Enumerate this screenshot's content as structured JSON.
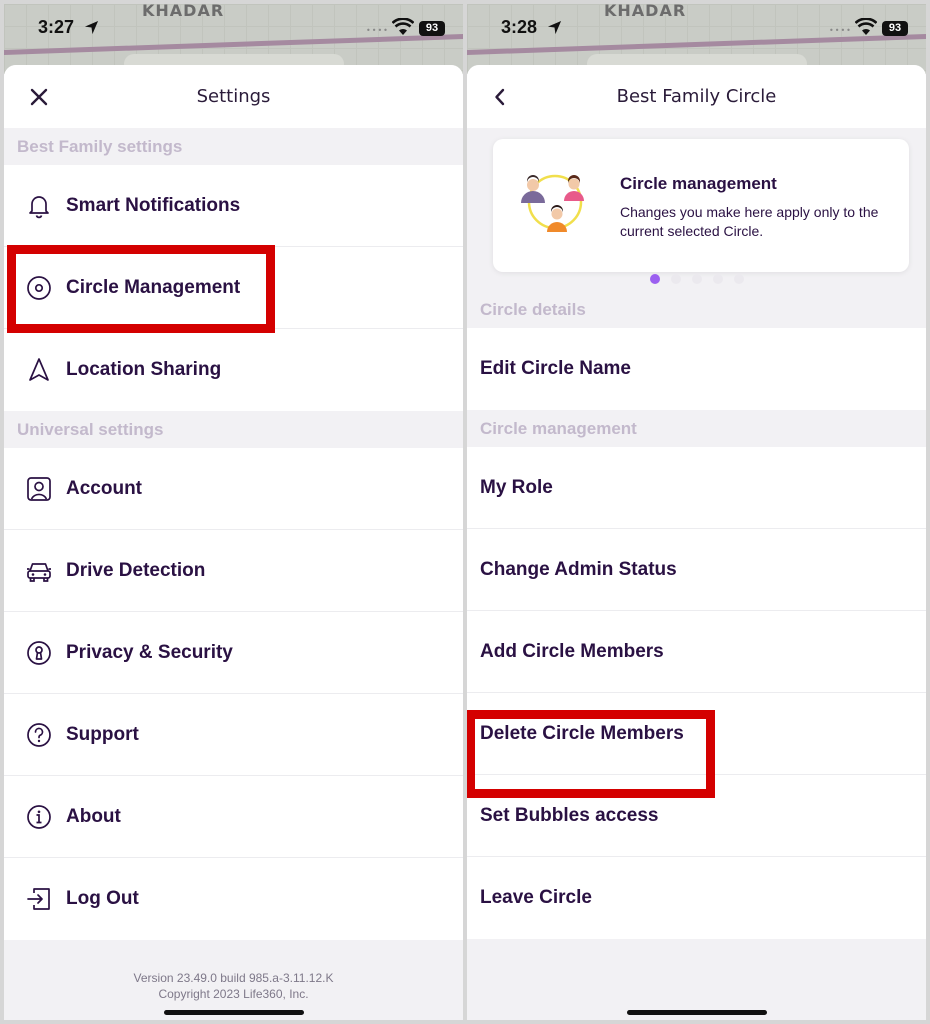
{
  "colors": {
    "highlight": "#d40000",
    "accent": "#9c60f0",
    "text": "#2a1143",
    "section_text": "#c3b9cc"
  },
  "left": {
    "status": {
      "time": "3:27",
      "battery": "93"
    },
    "map_label": "KHADAR",
    "header": {
      "title": "Settings",
      "close_icon": "close-icon"
    },
    "section_1": "Best Family settings",
    "family_items": [
      {
        "label": "Smart Notifications",
        "icon": "bell-icon"
      },
      {
        "label": "Circle Management",
        "icon": "circle-target-icon"
      },
      {
        "label": "Location Sharing",
        "icon": "navigation-arrow-icon"
      }
    ],
    "section_2": "Universal settings",
    "universal_items": [
      {
        "label": "Account",
        "icon": "user-icon"
      },
      {
        "label": "Drive Detection",
        "icon": "car-icon"
      },
      {
        "label": "Privacy & Security",
        "icon": "keyhole-icon"
      },
      {
        "label": "Support",
        "icon": "help-icon"
      },
      {
        "label": "About",
        "icon": "info-icon"
      },
      {
        "label": "Log Out",
        "icon": "logout-icon"
      }
    ],
    "footer": {
      "version": "Version 23.49.0 build 985.a-3.11.12.K",
      "copyright": "Copyright 2023 Life360, Inc."
    }
  },
  "right": {
    "status": {
      "time": "3:28",
      "battery": "93"
    },
    "map_label": "KHADAR",
    "header": {
      "title": "Best Family Circle",
      "back_icon": "back-chevron-icon"
    },
    "card": {
      "title": "Circle management",
      "description": "Changes you make here apply only to the current selected Circle."
    },
    "pager": {
      "count": 5,
      "active": 1
    },
    "section_1": "Circle details",
    "details_items": [
      {
        "label": "Edit Circle Name"
      }
    ],
    "section_2": "Circle management",
    "management_items": [
      {
        "label": "My Role"
      },
      {
        "label": "Change Admin Status"
      },
      {
        "label": "Add Circle Members"
      },
      {
        "label": "Delete Circle Members"
      },
      {
        "label": "Set Bubbles access"
      },
      {
        "label": "Leave Circle"
      }
    ]
  }
}
